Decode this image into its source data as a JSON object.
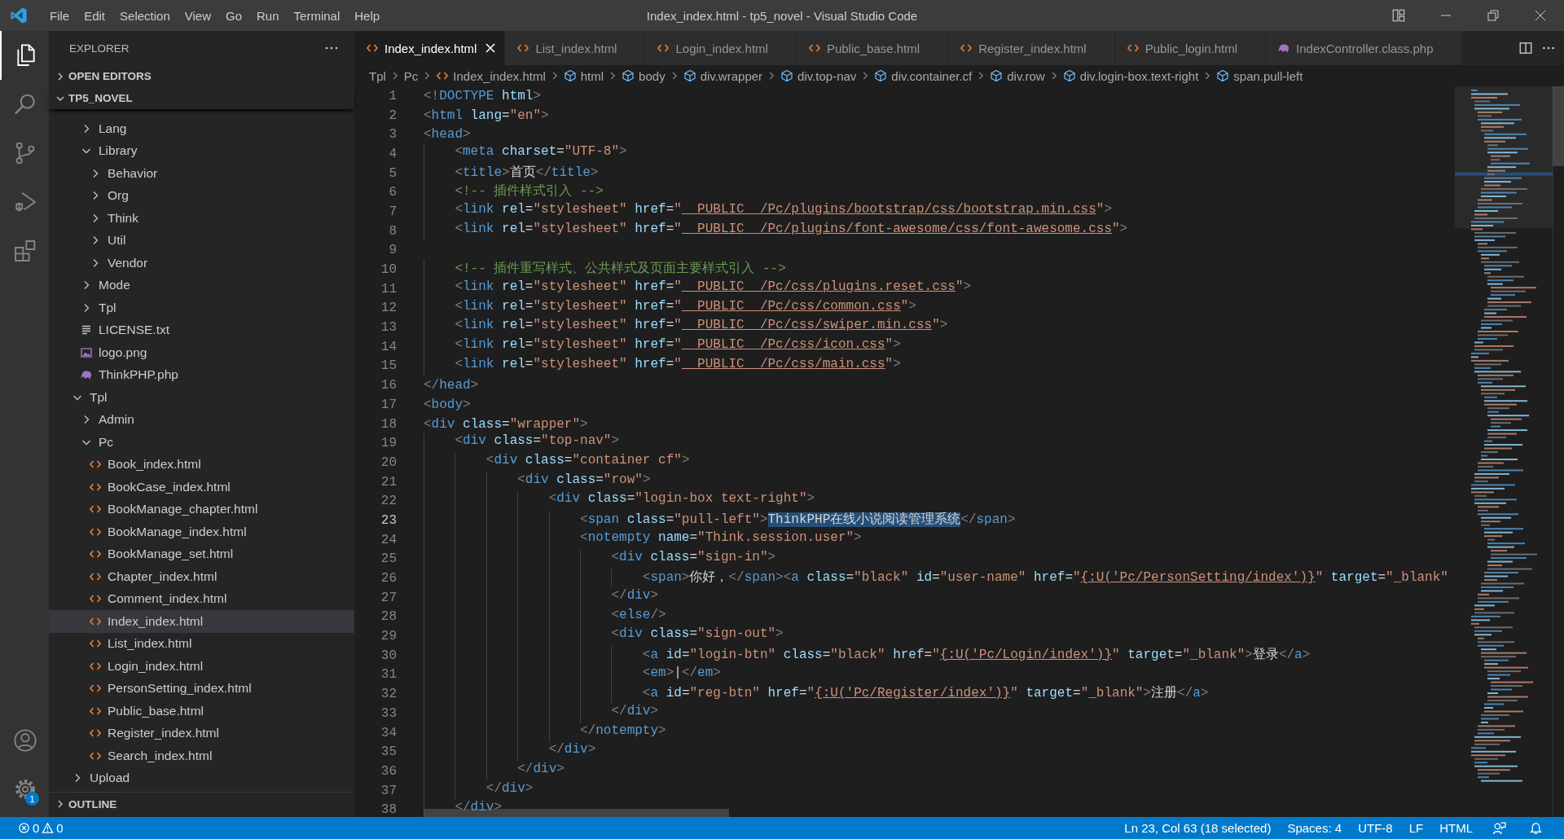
{
  "window": {
    "title": "Index_index.html - tp5_novel - Visual Studio Code"
  },
  "menu": [
    "File",
    "Edit",
    "Selection",
    "View",
    "Go",
    "Run",
    "Terminal",
    "Help"
  ],
  "activity_bar": {
    "top": [
      {
        "kind": "explorer",
        "selected": true
      },
      {
        "kind": "search",
        "selected": false
      },
      {
        "kind": "source-control",
        "selected": false
      },
      {
        "kind": "run-debug",
        "selected": false
      },
      {
        "kind": "extensions",
        "selected": false
      }
    ],
    "bottom": [
      {
        "kind": "account",
        "selected": false
      },
      {
        "kind": "settings",
        "selected": false,
        "badge": "1"
      }
    ]
  },
  "sidebar": {
    "title": "EXPLORER",
    "open_editors": {
      "label": "OPEN EDITORS",
      "expanded": false
    },
    "project": {
      "label": "TP5_NOVEL",
      "expanded": true
    },
    "tree": [
      {
        "children": [
          {
            "label": "Lang",
            "kind": "folder",
            "expanded": false,
            "selected": false
          },
          {
            "label": "Library",
            "kind": "folder",
            "expanded": true,
            "selected": false,
            "children": [
              {
                "label": "Behavior",
                "kind": "folder",
                "expanded": false,
                "selected": false
              },
              {
                "label": "Org",
                "kind": "folder",
                "expanded": false,
                "selected": false
              },
              {
                "label": "Think",
                "kind": "folder",
                "expanded": false,
                "selected": false
              },
              {
                "label": "Util",
                "kind": "folder",
                "expanded": false,
                "selected": false
              },
              {
                "label": "Vendor",
                "kind": "folder",
                "expanded": false,
                "selected": false
              }
            ]
          },
          {
            "label": "Mode",
            "kind": "folder",
            "expanded": false,
            "selected": false
          },
          {
            "label": "Tpl",
            "kind": "folder",
            "expanded": false,
            "selected": false
          },
          {
            "label": "LICENSE.txt",
            "kind": "text",
            "selected": false
          },
          {
            "label": "logo.png",
            "kind": "image",
            "selected": false
          },
          {
            "label": "ThinkPHP.php",
            "kind": "php",
            "selected": false
          }
        ]
      },
      {
        "label": "Tpl",
        "kind": "folder",
        "expanded": true,
        "selected": false,
        "children": [
          {
            "label": "Admin",
            "kind": "folder",
            "expanded": false,
            "selected": false
          },
          {
            "label": "Pc",
            "kind": "folder",
            "expanded": true,
            "selected": false,
            "children": [
              {
                "label": "Book_index.html",
                "kind": "html",
                "selected": false
              },
              {
                "label": "BookCase_index.html",
                "kind": "html",
                "selected": false
              },
              {
                "label": "BookManage_chapter.html",
                "kind": "html",
                "selected": false
              },
              {
                "label": "BookManage_index.html",
                "kind": "html",
                "selected": false
              },
              {
                "label": "BookManage_set.html",
                "kind": "html",
                "selected": false
              },
              {
                "label": "Chapter_index.html",
                "kind": "html",
                "selected": false
              },
              {
                "label": "Comment_index.html",
                "kind": "html",
                "selected": false
              },
              {
                "label": "Index_index.html",
                "kind": "html",
                "selected": true
              },
              {
                "label": "List_index.html",
                "kind": "html",
                "selected": false
              },
              {
                "label": "Login_index.html",
                "kind": "html",
                "selected": false
              },
              {
                "label": "PersonSetting_index.html",
                "kind": "html",
                "selected": false
              },
              {
                "label": "Public_base.html",
                "kind": "html",
                "selected": false
              },
              {
                "label": "Register_index.html",
                "kind": "html",
                "selected": false
              },
              {
                "label": "Search_index.html",
                "kind": "html",
                "selected": false
              }
            ]
          }
        ]
      },
      {
        "label": "Upload",
        "kind": "folder",
        "expanded": false,
        "selected": false
      }
    ],
    "outline": {
      "label": "OUTLINE",
      "expanded": false
    }
  },
  "tabs": [
    {
      "label": "Index_index.html",
      "kind": "html",
      "selected": true
    },
    {
      "label": "List_index.html",
      "kind": "html",
      "selected": false
    },
    {
      "label": "Login_index.html",
      "kind": "html",
      "selected": false
    },
    {
      "label": "Public_base.html",
      "kind": "html",
      "selected": false
    },
    {
      "label": "Register_index.html",
      "kind": "html",
      "selected": false
    },
    {
      "label": "Public_login.html",
      "kind": "html",
      "selected": false
    },
    {
      "label": "IndexController.class.php",
      "kind": "php",
      "selected": false
    }
  ],
  "breadcrumbs": [
    {
      "label": "Tpl",
      "kind": "folder"
    },
    {
      "label": "Pc",
      "kind": "folder"
    },
    {
      "label": "Index_index.html",
      "kind": "html"
    },
    {
      "label": "html",
      "kind": "element"
    },
    {
      "label": "body",
      "kind": "element"
    },
    {
      "label": "div.wrapper",
      "kind": "element"
    },
    {
      "label": "div.top-nav",
      "kind": "element"
    },
    {
      "label": "div.container.cf",
      "kind": "element"
    },
    {
      "label": "div.row",
      "kind": "element"
    },
    {
      "label": "div.login-box.text-right",
      "kind": "element"
    },
    {
      "label": "span.pull-left",
      "kind": "element"
    }
  ],
  "editor": {
    "lines": [
      {
        "number": "1",
        "current": false,
        "tokens": [
          {
            "kind": "punct",
            "text": "<!"
          },
          {
            "kind": "tag",
            "text": "DOCTYPE"
          },
          {
            "kind": "attr",
            "text": " html"
          },
          {
            "kind": "punct",
            "text": ">"
          }
        ]
      },
      {
        "number": "2",
        "current": false,
        "tokens": [
          {
            "kind": "punct",
            "text": "<"
          },
          {
            "kind": "tag",
            "text": "html"
          },
          {
            "kind": "attr",
            "text": " lang"
          },
          {
            "kind": "text",
            "text": "="
          },
          {
            "kind": "string",
            "text": "\"en\""
          },
          {
            "kind": "punct",
            "text": ">"
          }
        ]
      },
      {
        "number": "3",
        "current": false,
        "tokens": [
          {
            "kind": "punct",
            "text": "<"
          },
          {
            "kind": "tag",
            "text": "head"
          },
          {
            "kind": "punct",
            "text": ">"
          }
        ]
      },
      {
        "number": "4",
        "current": false,
        "tokens": [
          {
            "kind": "punct",
            "text": "    <"
          },
          {
            "kind": "tag",
            "text": "meta"
          },
          {
            "kind": "attr",
            "text": " charset"
          },
          {
            "kind": "text",
            "text": "="
          },
          {
            "kind": "string",
            "text": "\"UTF-8\""
          },
          {
            "kind": "punct",
            "text": ">"
          }
        ]
      },
      {
        "number": "5",
        "current": false,
        "tokens": [
          {
            "kind": "punct",
            "text": "    <"
          },
          {
            "kind": "tag",
            "text": "title"
          },
          {
            "kind": "punct",
            "text": ">"
          },
          {
            "kind": "text",
            "text": "首页"
          },
          {
            "kind": "punct",
            "text": "</"
          },
          {
            "kind": "tag",
            "text": "title"
          },
          {
            "kind": "punct",
            "text": ">"
          }
        ]
      },
      {
        "number": "6",
        "current": false,
        "tokens": [
          {
            "kind": "comment",
            "text": "    <!-- 插件样式引入 -->"
          }
        ]
      },
      {
        "number": "7",
        "current": false,
        "tokens": [
          {
            "kind": "punct",
            "text": "    <"
          },
          {
            "kind": "tag",
            "text": "link"
          },
          {
            "kind": "attr",
            "text": " rel"
          },
          {
            "kind": "text",
            "text": "="
          },
          {
            "kind": "string",
            "text": "\"stylesheet\""
          },
          {
            "kind": "attr",
            "text": " href"
          },
          {
            "kind": "text",
            "text": "="
          },
          {
            "kind": "string",
            "text": "\""
          },
          {
            "kind": "link",
            "text": "__PUBLIC__/Pc/plugins/bootstrap/css/bootstrap.min.css"
          },
          {
            "kind": "string",
            "text": "\""
          },
          {
            "kind": "punct",
            "text": ">"
          }
        ]
      },
      {
        "number": "8",
        "current": false,
        "tokens": [
          {
            "kind": "punct",
            "text": "    <"
          },
          {
            "kind": "tag",
            "text": "link"
          },
          {
            "kind": "attr",
            "text": " rel"
          },
          {
            "kind": "text",
            "text": "="
          },
          {
            "kind": "string",
            "text": "\"stylesheet\""
          },
          {
            "kind": "attr",
            "text": " href"
          },
          {
            "kind": "text",
            "text": "="
          },
          {
            "kind": "string",
            "text": "\""
          },
          {
            "kind": "link",
            "text": "__PUBLIC__/Pc/plugins/font-awesome/css/font-awesome.css"
          },
          {
            "kind": "string",
            "text": "\""
          },
          {
            "kind": "punct",
            "text": ">"
          }
        ]
      },
      {
        "number": "9",
        "current": false
      },
      {
        "number": "10",
        "current": false,
        "tokens": [
          {
            "kind": "comment",
            "text": "    <!-- 插件重写样式、公共样式及页面主要样式引入 -->"
          }
        ]
      },
      {
        "number": "11",
        "current": false,
        "tokens": [
          {
            "kind": "punct",
            "text": "    <"
          },
          {
            "kind": "tag",
            "text": "link"
          },
          {
            "kind": "attr",
            "text": " rel"
          },
          {
            "kind": "text",
            "text": "="
          },
          {
            "kind": "string",
            "text": "\"stylesheet\""
          },
          {
            "kind": "attr",
            "text": " href"
          },
          {
            "kind": "text",
            "text": "="
          },
          {
            "kind": "string",
            "text": "\""
          },
          {
            "kind": "link",
            "text": "__PUBLIC__/Pc/css/plugins.reset.css"
          },
          {
            "kind": "string",
            "text": "\""
          },
          {
            "kind": "punct",
            "text": ">"
          }
        ]
      },
      {
        "number": "12",
        "current": false,
        "tokens": [
          {
            "kind": "punct",
            "text": "    <"
          },
          {
            "kind": "tag",
            "text": "link"
          },
          {
            "kind": "attr",
            "text": " rel"
          },
          {
            "kind": "text",
            "text": "="
          },
          {
            "kind": "string",
            "text": "\"stylesheet\""
          },
          {
            "kind": "attr",
            "text": " href"
          },
          {
            "kind": "text",
            "text": "="
          },
          {
            "kind": "string",
            "text": "\""
          },
          {
            "kind": "link",
            "text": "__PUBLIC__/Pc/css/common.css"
          },
          {
            "kind": "string",
            "text": "\""
          },
          {
            "kind": "punct",
            "text": ">"
          }
        ]
      },
      {
        "number": "13",
        "current": false,
        "tokens": [
          {
            "kind": "punct",
            "text": "    <"
          },
          {
            "kind": "tag",
            "text": "link"
          },
          {
            "kind": "attr",
            "text": " rel"
          },
          {
            "kind": "text",
            "text": "="
          },
          {
            "kind": "string",
            "text": "\"stylesheet\""
          },
          {
            "kind": "attr",
            "text": " href"
          },
          {
            "kind": "text",
            "text": "="
          },
          {
            "kind": "string",
            "text": "\""
          },
          {
            "kind": "link",
            "text": "__PUBLIC__/Pc/css/swiper.min.css"
          },
          {
            "kind": "string",
            "text": "\""
          },
          {
            "kind": "punct",
            "text": ">"
          }
        ]
      },
      {
        "number": "14",
        "current": false,
        "tokens": [
          {
            "kind": "punct",
            "text": "    <"
          },
          {
            "kind": "tag",
            "text": "link"
          },
          {
            "kind": "attr",
            "text": " rel"
          },
          {
            "kind": "text",
            "text": "="
          },
          {
            "kind": "string",
            "text": "\"stylesheet\""
          },
          {
            "kind": "attr",
            "text": " href"
          },
          {
            "kind": "text",
            "text": "="
          },
          {
            "kind": "string",
            "text": "\""
          },
          {
            "kind": "link",
            "text": "__PUBLIC__/Pc/css/icon.css"
          },
          {
            "kind": "string",
            "text": "\""
          },
          {
            "kind": "punct",
            "text": ">"
          }
        ]
      },
      {
        "number": "15",
        "current": false,
        "tokens": [
          {
            "kind": "punct",
            "text": "    <"
          },
          {
            "kind": "tag",
            "text": "link"
          },
          {
            "kind": "attr",
            "text": " rel"
          },
          {
            "kind": "text",
            "text": "="
          },
          {
            "kind": "string",
            "text": "\"stylesheet\""
          },
          {
            "kind": "attr",
            "text": " href"
          },
          {
            "kind": "text",
            "text": "="
          },
          {
            "kind": "string",
            "text": "\""
          },
          {
            "kind": "link",
            "text": "__PUBLIC__/Pc/css/main.css"
          },
          {
            "kind": "string",
            "text": "\""
          },
          {
            "kind": "punct",
            "text": ">"
          }
        ]
      },
      {
        "number": "16",
        "current": false,
        "tokens": [
          {
            "kind": "punct",
            "text": "</"
          },
          {
            "kind": "tag",
            "text": "head"
          },
          {
            "kind": "punct",
            "text": ">"
          }
        ]
      },
      {
        "number": "17",
        "current": false,
        "tokens": [
          {
            "kind": "punct",
            "text": "<"
          },
          {
            "kind": "tag",
            "text": "body"
          },
          {
            "kind": "punct",
            "text": ">"
          }
        ]
      },
      {
        "number": "18",
        "current": false,
        "tokens": [
          {
            "kind": "punct",
            "text": "<"
          },
          {
            "kind": "tag",
            "text": "div"
          },
          {
            "kind": "attr",
            "text": " class"
          },
          {
            "kind": "text",
            "text": "="
          },
          {
            "kind": "string",
            "text": "\"wrapper\""
          },
          {
            "kind": "punct",
            "text": ">"
          }
        ]
      },
      {
        "number": "19",
        "current": false,
        "tokens": [
          {
            "kind": "punct",
            "text": "    <"
          },
          {
            "kind": "tag",
            "text": "div"
          },
          {
            "kind": "attr",
            "text": " class"
          },
          {
            "kind": "text",
            "text": "="
          },
          {
            "kind": "string",
            "text": "\"top-nav\""
          },
          {
            "kind": "punct",
            "text": ">"
          }
        ]
      },
      {
        "number": "20",
        "current": false,
        "tokens": [
          {
            "kind": "punct",
            "text": "        <"
          },
          {
            "kind": "tag",
            "text": "div"
          },
          {
            "kind": "attr",
            "text": " class"
          },
          {
            "kind": "text",
            "text": "="
          },
          {
            "kind": "string",
            "text": "\"container cf\""
          },
          {
            "kind": "punct",
            "text": ">"
          }
        ]
      },
      {
        "number": "21",
        "current": false,
        "tokens": [
          {
            "kind": "punct",
            "text": "            <"
          },
          {
            "kind": "tag",
            "text": "div"
          },
          {
            "kind": "attr",
            "text": " class"
          },
          {
            "kind": "text",
            "text": "="
          },
          {
            "kind": "string",
            "text": "\"row\""
          },
          {
            "kind": "punct",
            "text": ">"
          }
        ]
      },
      {
        "number": "22",
        "current": false,
        "tokens": [
          {
            "kind": "punct",
            "text": "                <"
          },
          {
            "kind": "tag",
            "text": "div"
          },
          {
            "kind": "attr",
            "text": " class"
          },
          {
            "kind": "text",
            "text": "="
          },
          {
            "kind": "string",
            "text": "\"login-box text-right\""
          },
          {
            "kind": "punct",
            "text": ">"
          }
        ]
      },
      {
        "number": "23",
        "current": true,
        "tokens": [
          {
            "kind": "punct",
            "text": "                    <"
          },
          {
            "kind": "tag",
            "text": "span"
          },
          {
            "kind": "attr",
            "text": " class"
          },
          {
            "kind": "text",
            "text": "="
          },
          {
            "kind": "string",
            "text": "\"pull-left\""
          },
          {
            "kind": "punct",
            "text": ">"
          },
          {
            "kind": "selection",
            "text": "ThinkPHP在线小说阅读管理系统"
          },
          {
            "kind": "punct",
            "text": "</"
          },
          {
            "kind": "tag",
            "text": "span"
          },
          {
            "kind": "punct",
            "text": ">"
          }
        ]
      },
      {
        "number": "24",
        "current": false,
        "tokens": [
          {
            "kind": "punct",
            "text": "                    <"
          },
          {
            "kind": "tag",
            "text": "notempty"
          },
          {
            "kind": "attr",
            "text": " name"
          },
          {
            "kind": "text",
            "text": "="
          },
          {
            "kind": "string",
            "text": "\"Think.session.user\""
          },
          {
            "kind": "punct",
            "text": ">"
          }
        ]
      },
      {
        "number": "25",
        "current": false,
        "tokens": [
          {
            "kind": "punct",
            "text": "                        <"
          },
          {
            "kind": "tag",
            "text": "div"
          },
          {
            "kind": "attr",
            "text": " class"
          },
          {
            "kind": "text",
            "text": "="
          },
          {
            "kind": "string",
            "text": "\"sign-in\""
          },
          {
            "kind": "punct",
            "text": ">"
          }
        ]
      },
      {
        "number": "26",
        "current": false,
        "tokens": [
          {
            "kind": "punct",
            "text": "                            <"
          },
          {
            "kind": "tag",
            "text": "span"
          },
          {
            "kind": "punct",
            "text": ">"
          },
          {
            "kind": "text",
            "text": "你好，"
          },
          {
            "kind": "punct",
            "text": "</"
          },
          {
            "kind": "tag",
            "text": "span"
          },
          {
            "kind": "punct",
            "text": "><"
          },
          {
            "kind": "tag",
            "text": "a"
          },
          {
            "kind": "attr",
            "text": " class"
          },
          {
            "kind": "text",
            "text": "="
          },
          {
            "kind": "string",
            "text": "\"black\""
          },
          {
            "kind": "attr",
            "text": " id"
          },
          {
            "kind": "text",
            "text": "="
          },
          {
            "kind": "string",
            "text": "\"user-name\""
          },
          {
            "kind": "attr",
            "text": " href"
          },
          {
            "kind": "text",
            "text": "="
          },
          {
            "kind": "string",
            "text": "\""
          },
          {
            "kind": "link",
            "text": "{:U('Pc/PersonSetting/index')}"
          },
          {
            "kind": "string",
            "text": "\""
          },
          {
            "kind": "attr",
            "text": " target"
          },
          {
            "kind": "text",
            "text": "="
          },
          {
            "kind": "string",
            "text": "\"_blank\""
          }
        ]
      },
      {
        "number": "27",
        "current": false,
        "tokens": [
          {
            "kind": "punct",
            "text": "                        </"
          },
          {
            "kind": "tag",
            "text": "div"
          },
          {
            "kind": "punct",
            "text": ">"
          }
        ]
      },
      {
        "number": "28",
        "current": false,
        "tokens": [
          {
            "kind": "punct",
            "text": "                        <"
          },
          {
            "kind": "tag",
            "text": "else"
          },
          {
            "kind": "punct",
            "text": "/>"
          }
        ]
      },
      {
        "number": "29",
        "current": false,
        "tokens": [
          {
            "kind": "punct",
            "text": "                        <"
          },
          {
            "kind": "tag",
            "text": "div"
          },
          {
            "kind": "attr",
            "text": " class"
          },
          {
            "kind": "text",
            "text": "="
          },
          {
            "kind": "string",
            "text": "\"sign-out\""
          },
          {
            "kind": "punct",
            "text": ">"
          }
        ]
      },
      {
        "number": "30",
        "current": false,
        "tokens": [
          {
            "kind": "punct",
            "text": "                            <"
          },
          {
            "kind": "tag",
            "text": "a"
          },
          {
            "kind": "attr",
            "text": " id"
          },
          {
            "kind": "text",
            "text": "="
          },
          {
            "kind": "string",
            "text": "\"login-btn\""
          },
          {
            "kind": "attr",
            "text": " class"
          },
          {
            "kind": "text",
            "text": "="
          },
          {
            "kind": "string",
            "text": "\"black\""
          },
          {
            "kind": "attr",
            "text": " href"
          },
          {
            "kind": "text",
            "text": "="
          },
          {
            "kind": "string",
            "text": "\""
          },
          {
            "kind": "link",
            "text": "{:U('Pc/Login/index')}"
          },
          {
            "kind": "string",
            "text": "\""
          },
          {
            "kind": "attr",
            "text": " target"
          },
          {
            "kind": "text",
            "text": "="
          },
          {
            "kind": "string",
            "text": "\"_blank\""
          },
          {
            "kind": "punct",
            "text": ">"
          },
          {
            "kind": "text",
            "text": "登录"
          },
          {
            "kind": "punct",
            "text": "</"
          },
          {
            "kind": "tag",
            "text": "a"
          },
          {
            "kind": "punct",
            "text": ">"
          }
        ]
      },
      {
        "number": "31",
        "current": false,
        "tokens": [
          {
            "kind": "punct",
            "text": "                            <"
          },
          {
            "kind": "tag",
            "text": "em"
          },
          {
            "kind": "punct",
            "text": ">"
          },
          {
            "kind": "text",
            "text": "|"
          },
          {
            "kind": "punct",
            "text": "</"
          },
          {
            "kind": "tag",
            "text": "em"
          },
          {
            "kind": "punct",
            "text": ">"
          }
        ]
      },
      {
        "number": "32",
        "current": false,
        "tokens": [
          {
            "kind": "punct",
            "text": "                            <"
          },
          {
            "kind": "tag",
            "text": "a"
          },
          {
            "kind": "attr",
            "text": " id"
          },
          {
            "kind": "text",
            "text": "="
          },
          {
            "kind": "string",
            "text": "\"reg-btn\""
          },
          {
            "kind": "attr",
            "text": " href"
          },
          {
            "kind": "text",
            "text": "="
          },
          {
            "kind": "string",
            "text": "\""
          },
          {
            "kind": "link",
            "text": "{:U('Pc/Register/index')}"
          },
          {
            "kind": "string",
            "text": "\""
          },
          {
            "kind": "attr",
            "text": " target"
          },
          {
            "kind": "text",
            "text": "="
          },
          {
            "kind": "string",
            "text": "\"_blank\""
          },
          {
            "kind": "punct",
            "text": ">"
          },
          {
            "kind": "text",
            "text": "注册"
          },
          {
            "kind": "punct",
            "text": "</"
          },
          {
            "kind": "tag",
            "text": "a"
          },
          {
            "kind": "punct",
            "text": ">"
          }
        ]
      },
      {
        "number": "33",
        "current": false,
        "tokens": [
          {
            "kind": "punct",
            "text": "                        </"
          },
          {
            "kind": "tag",
            "text": "div"
          },
          {
            "kind": "punct",
            "text": ">"
          }
        ]
      },
      {
        "number": "34",
        "current": false,
        "tokens": [
          {
            "kind": "punct",
            "text": "                    </"
          },
          {
            "kind": "tag",
            "text": "notempty"
          },
          {
            "kind": "punct",
            "text": ">"
          }
        ]
      },
      {
        "number": "35",
        "current": false,
        "tokens": [
          {
            "kind": "punct",
            "text": "                </"
          },
          {
            "kind": "tag",
            "text": "div"
          },
          {
            "kind": "punct",
            "text": ">"
          }
        ]
      },
      {
        "number": "36",
        "current": false,
        "tokens": [
          {
            "kind": "punct",
            "text": "            </"
          },
          {
            "kind": "tag",
            "text": "div"
          },
          {
            "kind": "punct",
            "text": ">"
          }
        ]
      },
      {
        "number": "37",
        "current": false,
        "tokens": [
          {
            "kind": "punct",
            "text": "        </"
          },
          {
            "kind": "tag",
            "text": "div"
          },
          {
            "kind": "punct",
            "text": ">"
          }
        ]
      },
      {
        "number": "38",
        "current": false,
        "tokens": [
          {
            "kind": "punct",
            "text": "    </"
          },
          {
            "kind": "tag",
            "text": "div"
          },
          {
            "kind": "punct",
            "text": ">"
          }
        ]
      }
    ]
  },
  "status_bar": {
    "errors": "0",
    "warnings": "0",
    "position": "Ln 23, Col 63 (18 selected)",
    "indentation": "Spaces: 4",
    "encoding": "UTF-8",
    "line_ending": "LF",
    "language": "HTML"
  }
}
